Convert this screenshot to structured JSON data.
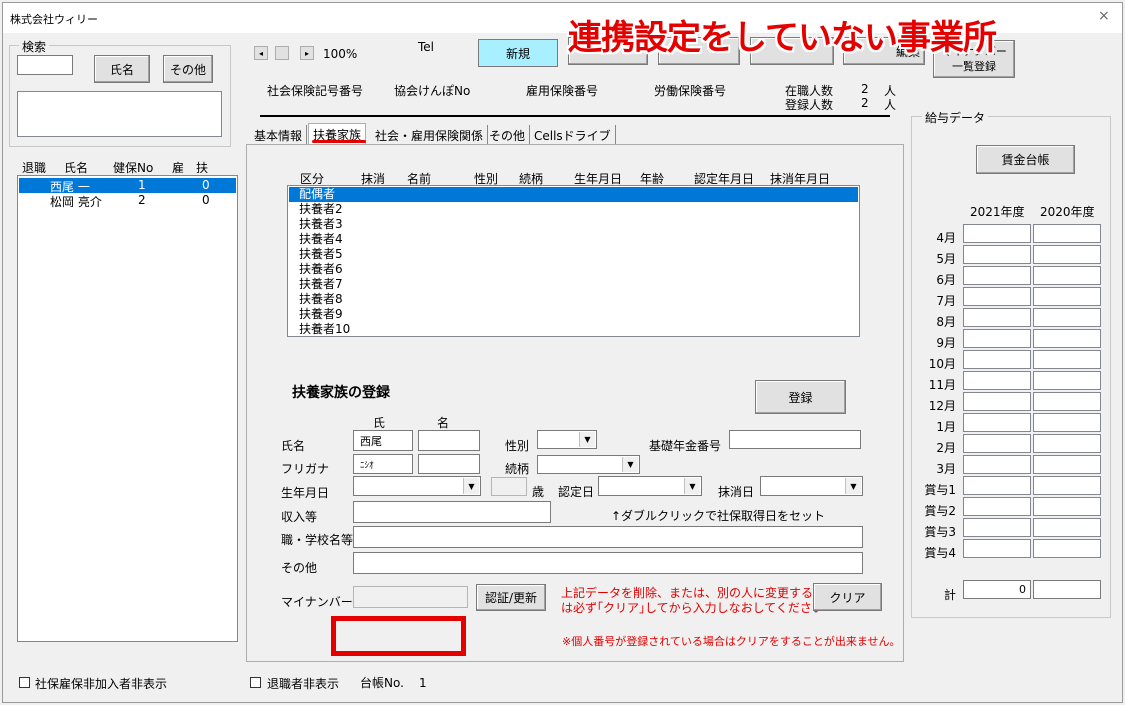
{
  "window": {
    "title": "株式会社ウィリー",
    "close": "×"
  },
  "search": {
    "group_label": "検索",
    "name_button": "氏名",
    "other_button": "その他",
    "list_headers": [
      "退職",
      "氏名",
      "健保No",
      "雇",
      "扶"
    ],
    "employees": [
      {
        "retired": "",
        "name": "西尾 一",
        "kenpo": "1",
        "koyo": "",
        "dependents": "0",
        "selected": true
      },
      {
        "retired": "",
        "name": "松岡 亮介",
        "kenpo": "2",
        "koyo": "",
        "dependents": "0",
        "selected": false
      }
    ]
  },
  "toolbar": {
    "prev": "◂",
    "next": "▸",
    "zoom": "100%",
    "tel_label": "Tel",
    "new_button": "新規",
    "hidden_buttons": [
      "",
      "",
      "",
      "編集"
    ],
    "mynumber_button_line1": "マイナンバー",
    "mynumber_button_line2": "一覧登録"
  },
  "header_fields": {
    "shaho": "社会保険記号番号",
    "kyokai": "協会けんぽNo",
    "koyo": "雇用保険番号",
    "rodo": "労働保険番号",
    "zaishoku_label": "在職人数",
    "zaishoku_value": "2",
    "zaishoku_unit": "人",
    "toroku_label": "登録人数",
    "toroku_value": "2",
    "toroku_unit": "人"
  },
  "tabs": [
    "基本情報",
    "扶養家族",
    "社会・雇用保険関係",
    "その他",
    "Cellsドライブ"
  ],
  "dependents_list": {
    "headers": [
      "区分",
      "抹消",
      "名前",
      "性別",
      "続柄",
      "生年月日",
      "年齢",
      "認定年月日",
      "抹消年月日"
    ],
    "rows": [
      "配偶者",
      "扶養者2",
      "扶養者3",
      "扶養者4",
      "扶養者5",
      "扶養者6",
      "扶養者7",
      "扶養者8",
      "扶養者9",
      "扶養者10"
    ]
  },
  "form": {
    "section_title": "扶養家族の登録",
    "register_button": "登録",
    "col_shi": "氏",
    "col_mei": "名",
    "name_label": "氏名",
    "last_name_value": "西尾",
    "furigana_label": "フリガナ",
    "furigana_value": "ﾆｼｵ",
    "gender_label": "性別",
    "relation_label": "続柄",
    "pension_label": "基礎年金番号",
    "birth_label": "生年月日",
    "age_unit": "歳",
    "nintei_label": "認定日",
    "massho_label": "抹消日",
    "income_label": "収入等",
    "hint": "↑ダブルクリックで社保取得日をセット",
    "job_label": "職・学校名等",
    "other_label": "その他",
    "mynumber_label": "マイナンバー",
    "auth_button": "認証/更新",
    "warning_line1": "上記データを削除、または、別の人に変更する場合",
    "warning_line2": "は必ず｢クリア｣してから入力しなおしてください⇒⇒",
    "clear_button": "クリア",
    "note": "※個人番号が登録されている場合はクリアをすることが出来ません。"
  },
  "salary": {
    "group_label": "給与データ",
    "ledger_button": "賃金台帳",
    "years": [
      "2021年度",
      "2020年度"
    ],
    "months": [
      "4月",
      "5月",
      "6月",
      "7月",
      "8月",
      "9月",
      "10月",
      "11月",
      "12月",
      "1月",
      "2月",
      "3月",
      "賞与1",
      "賞与2",
      "賞与3",
      "賞与4"
    ],
    "total_label": "計",
    "total_2021": "0",
    "total_2020": ""
  },
  "footer": {
    "hide_unenrolled": "社保雇保非加入者非表示",
    "hide_retired": "退職者非表示",
    "ledger_no_label": "台帳No.",
    "ledger_no_value": "1"
  },
  "annotation": {
    "title": "連携設定をしていない事業所",
    "color": "#e50000"
  }
}
